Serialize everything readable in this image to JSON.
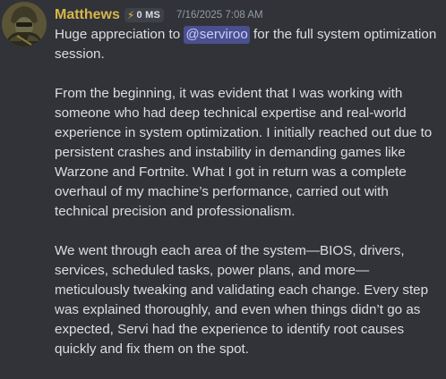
{
  "message": {
    "author": "Matthews",
    "tag": {
      "icon": "lightning-bolt-icon",
      "label": "0 MS"
    },
    "timestamp": "7/16/2025 7:08 AM",
    "mention": "@serviroo",
    "paragraph_1_before": "Huge appreciation to ",
    "paragraph_1_after": "  for the full system optimization session.",
    "paragraph_2": "From the beginning, it was evident that I was working with someone who had deep technical expertise and real-world experience in system optimization. I initially reached out due to persistent crashes and instability in demanding games like Warzone and Fortnite. What I got in return was a complete overhaul of my machine’s performance, carried out with technical precision and professionalism.",
    "paragraph_3": "We went through each area of the system—BIOS, drivers, services, scheduled tasks, power plans, and more—meticulously tweaking and validating each change. Every step was explained thoroughly, and even when things didn’t go as expected, Servi had the experience to identify root causes quickly and fix them on the spot."
  },
  "colors": {
    "background": "#313338",
    "username": "#d8b64a",
    "text": "#dbdee1",
    "timestamp": "#949ba4",
    "mention_bg": "#4a4f8f",
    "mention_text": "#c9cdfb"
  }
}
